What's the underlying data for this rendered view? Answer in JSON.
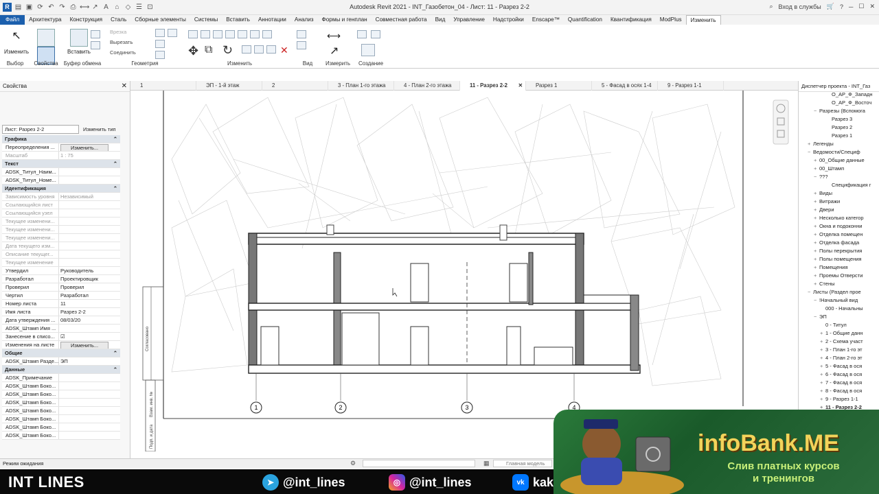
{
  "titlebar": {
    "title": "Autodesk Revit 2021 - INT_Газобетон_04 - Лист: 11 - Разрез 2-2",
    "signin": "Вход в службы"
  },
  "menu": [
    "Файл",
    "Архитектура",
    "Конструкция",
    "Сталь",
    "Сборные элементы",
    "Системы",
    "Вставить",
    "Аннотации",
    "Анализ",
    "Формы и генплан",
    "Совместная работа",
    "Вид",
    "Управление",
    "Надстройки",
    "Enscape™",
    "Quantification",
    "Квантификация",
    "ModPlus",
    "Изменить"
  ],
  "ribbon": {
    "select_label": "Выбор",
    "props_label": "Свойства",
    "clipboard_label": "Буфер обмена",
    "geometry_label": "Геометрия",
    "modify_group_label": "Изменить",
    "view_label": "Вид",
    "measure_label": "Измерить",
    "create_label": "Создание",
    "modify_btn": "Изменить",
    "paste_btn": "Вставить",
    "cut": "Вырезать",
    "join": "Соединить",
    "cope": "Врезка"
  },
  "properties": {
    "title": "Свойства",
    "type": "Лист: Разрез 2-2",
    "edit_type": "Изменить тип",
    "rows": [
      {
        "k": "Графика",
        "sec": true
      },
      {
        "k": "Переопределения ...",
        "v": "Изменить...",
        "btn": true
      },
      {
        "k": "Масштаб",
        "v": "1 : 75",
        "dis": true
      },
      {
        "k": "Текст",
        "sec": true
      },
      {
        "k": "ADSK_Титул_Наим...",
        "v": ""
      },
      {
        "k": "ADSK_Титул_Номе...",
        "v": ""
      },
      {
        "k": "Идентификация",
        "sec": true
      },
      {
        "k": "Зависимость уровня",
        "v": "Независимый",
        "dis": true
      },
      {
        "k": "Ссылающийся лист",
        "v": "",
        "dis": true
      },
      {
        "k": "Ссылающийся узел",
        "v": "",
        "dis": true
      },
      {
        "k": "Текущее изменени...",
        "v": "",
        "dis": true
      },
      {
        "k": "Текущее изменени...",
        "v": "",
        "dis": true
      },
      {
        "k": "Текущее изменени...",
        "v": "",
        "dis": true
      },
      {
        "k": "Дата текущего изм...",
        "v": "",
        "dis": true
      },
      {
        "k": "Описание текущег...",
        "v": "",
        "dis": true
      },
      {
        "k": "Текущее изменение",
        "v": "",
        "dis": true
      },
      {
        "k": "Утвердил",
        "v": "Руководитель"
      },
      {
        "k": "Разработал",
        "v": "Проектировщик"
      },
      {
        "k": "Проверил",
        "v": "Проверил"
      },
      {
        "k": "Чертил",
        "v": "Разработал"
      },
      {
        "k": "Номер листа",
        "v": "11"
      },
      {
        "k": "Имя листа",
        "v": "Разрез 2-2"
      },
      {
        "k": "Дата утверждения ...",
        "v": "08/03/20"
      },
      {
        "k": "ADSK_Штамп Имя ...",
        "v": ""
      },
      {
        "k": "Занесение в списо...",
        "v": "☑"
      },
      {
        "k": "Изменения на листе",
        "v": "Изменить...",
        "btn": true
      },
      {
        "k": "Общие",
        "sec": true
      },
      {
        "k": "ADSK_Штамп Разде...",
        "v": "ЭП"
      },
      {
        "k": "Данные",
        "sec": true
      },
      {
        "k": "ADSK_Примечание",
        "v": ""
      },
      {
        "k": "ADSK_Штамп Боко...",
        "v": ""
      },
      {
        "k": "ADSK_Штамп Боко...",
        "v": ""
      },
      {
        "k": "ADSK_Штамп Боко...",
        "v": ""
      },
      {
        "k": "ADSK_Штамп Боко...",
        "v": ""
      },
      {
        "k": "ADSK_Штамп Боко...",
        "v": ""
      },
      {
        "k": "ADSK_Штамп Боко...",
        "v": ""
      },
      {
        "k": "ADSK_Штамп Боко...",
        "v": ""
      }
    ]
  },
  "tabs": [
    "1",
    "ЭП - 1-й этаж",
    "2",
    "3 - План 1-го этажа",
    "4 - План 2-го этажа",
    "11 - Разрез 2-2",
    "Разрез 1",
    "5 - Фасад в осях 1-4",
    "9 - Разрез 1-1"
  ],
  "active_tab_index": 5,
  "grid_labels": [
    "1",
    "2",
    "3",
    "4"
  ],
  "sheet_labels": [
    "Согласовано",
    "Взам. инв. №",
    "Подп. и дата"
  ],
  "browser": {
    "title": "Диспетчер проекта - INT_Газ",
    "nodes": [
      {
        "t": "О_АР_Ф_Западн",
        "d": 4
      },
      {
        "t": "О_АР_Ф_Восточ",
        "d": 4
      },
      {
        "t": "Разрезы (Вспомога",
        "d": 2,
        "tg": "−"
      },
      {
        "t": "Разрез 3",
        "d": 4
      },
      {
        "t": "Разрез 2",
        "d": 4
      },
      {
        "t": "Разрез 1",
        "d": 4
      },
      {
        "t": "Легенды",
        "d": 1,
        "tg": "+"
      },
      {
        "t": "Ведомости/Специф",
        "d": 1,
        "tg": "−"
      },
      {
        "t": "00_Общие данные",
        "d": 2,
        "tg": "+"
      },
      {
        "t": "00_Штамп",
        "d": 2,
        "tg": "+"
      },
      {
        "t": "???",
        "d": 2,
        "tg": "−"
      },
      {
        "t": "Спецификация г",
        "d": 4
      },
      {
        "t": "Виды",
        "d": 2,
        "tg": "+"
      },
      {
        "t": "Витражи",
        "d": 2,
        "tg": "+"
      },
      {
        "t": "Двери",
        "d": 2,
        "tg": "+"
      },
      {
        "t": "Несколько категор",
        "d": 2,
        "tg": "+"
      },
      {
        "t": "Окна и подоконни",
        "d": 2,
        "tg": "+"
      },
      {
        "t": "Отделка помещен",
        "d": 2,
        "tg": "+"
      },
      {
        "t": "Отделка фасада",
        "d": 2,
        "tg": "+"
      },
      {
        "t": "Полы перекрытия",
        "d": 2,
        "tg": "+"
      },
      {
        "t": "Полы помещения",
        "d": 2,
        "tg": "+"
      },
      {
        "t": "Помещения",
        "d": 2,
        "tg": "+"
      },
      {
        "t": "Проемы Отверсти",
        "d": 2,
        "tg": "+"
      },
      {
        "t": "Стены",
        "d": 2,
        "tg": "+"
      },
      {
        "t": "Листы (Раздел прое",
        "d": 1,
        "tg": "−"
      },
      {
        "t": "!Начальный вид",
        "d": 2,
        "tg": "−"
      },
      {
        "t": "000 - Начальны",
        "d": 3
      },
      {
        "t": "ЭП",
        "d": 2,
        "tg": "−"
      },
      {
        "t": "0 - Титул",
        "d": 3
      },
      {
        "t": "1 - Общие данн",
        "d": 3,
        "tg": "+"
      },
      {
        "t": "2 - Схема участ",
        "d": 3,
        "tg": "+"
      },
      {
        "t": "3 - План 1-го эт",
        "d": 3,
        "tg": "+"
      },
      {
        "t": "4 - План 2-го эт",
        "d": 3,
        "tg": "+"
      },
      {
        "t": "5 - Фасад в ося",
        "d": 3,
        "tg": "+"
      },
      {
        "t": "6 - Фасад в ося",
        "d": 3,
        "tg": "+"
      },
      {
        "t": "7 - Фасад в ося",
        "d": 3,
        "tg": "+"
      },
      {
        "t": "8 - Фасад в ося",
        "d": 3,
        "tg": "+"
      },
      {
        "t": "9 - Разрез 1-1",
        "d": 3,
        "tg": "+"
      },
      {
        "t": "11 - Разрез 2-2",
        "d": 3,
        "tg": "+",
        "bold": true
      }
    ]
  },
  "status": {
    "left": "Режим ожидания",
    "model": "Главная модель"
  },
  "bottom": {
    "brand": "INT LINES",
    "telegram": "@int_lines",
    "instagram": "@int_lines",
    "vk": "kak_"
  },
  "promo": {
    "title": "infoBank.ME",
    "sub1": "Слив платных курсов",
    "sub2": "и тренингов"
  }
}
